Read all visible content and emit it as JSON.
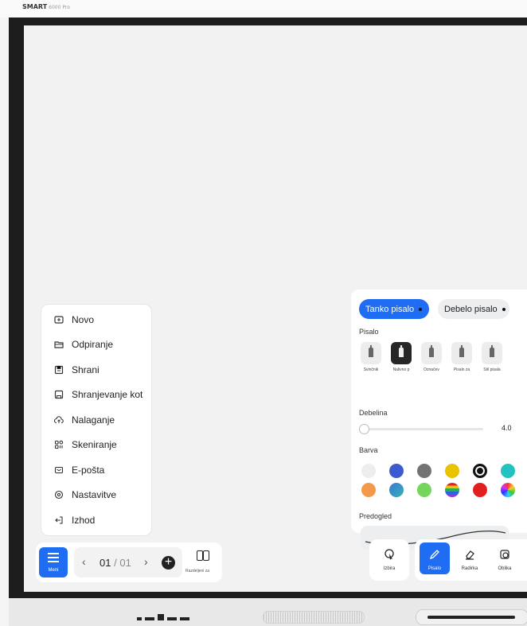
{
  "device": {
    "brand": "SMART",
    "model": "6000 Pro"
  },
  "file_menu": {
    "items": [
      {
        "label": "Novo",
        "icon": "new-file-icon"
      },
      {
        "label": "Odpiranje",
        "icon": "folder-open-icon"
      },
      {
        "label": "Shrani",
        "icon": "save-icon"
      },
      {
        "label": "Shranjevanje kot",
        "icon": "save-as-icon"
      },
      {
        "label": "Nalaganje",
        "icon": "cloud-upload-icon"
      },
      {
        "label": "Skeniranje",
        "icon": "qr-scan-icon"
      },
      {
        "label": "E-pošta",
        "icon": "mail-icon"
      },
      {
        "label": "Nastavitve",
        "icon": "settings-icon"
      },
      {
        "label": "Izhod",
        "icon": "exit-icon"
      }
    ]
  },
  "bottom_left": {
    "menu_label": "Meni",
    "page_current": "01",
    "page_separator": "/",
    "page_total": "01",
    "split_label": "Razdeljeni za"
  },
  "pen_panel": {
    "tab_thin": "Tanko pisalo",
    "tab_thick": "Debelo pisalo",
    "pen_section": "Pisalo",
    "pen_types": [
      "Svinčnik",
      "Nalivno p",
      "Označev",
      "Pisalo za",
      "Stil pisala"
    ],
    "selected_pen_index": 1,
    "thickness_label": "Debelina",
    "thickness_value": "4.0",
    "thickness_fraction": 0.02,
    "color_label": "Barva",
    "colors": [
      "#eeeeee",
      "#3b5bd1",
      "#737373",
      "#e9c400",
      "#111111",
      "#21c3c0",
      "#f39a4a",
      "multi-blue",
      "#74d65a",
      "multi-rainbow",
      "#e31e1e",
      "color-wheel"
    ],
    "selected_color_index": 4,
    "preview_label": "Predogled"
  },
  "bottom_right": {
    "select_label": "Izbira",
    "pen_label": "Pisalo",
    "eraser_label": "Radirka",
    "shape_label": "Oblika"
  }
}
